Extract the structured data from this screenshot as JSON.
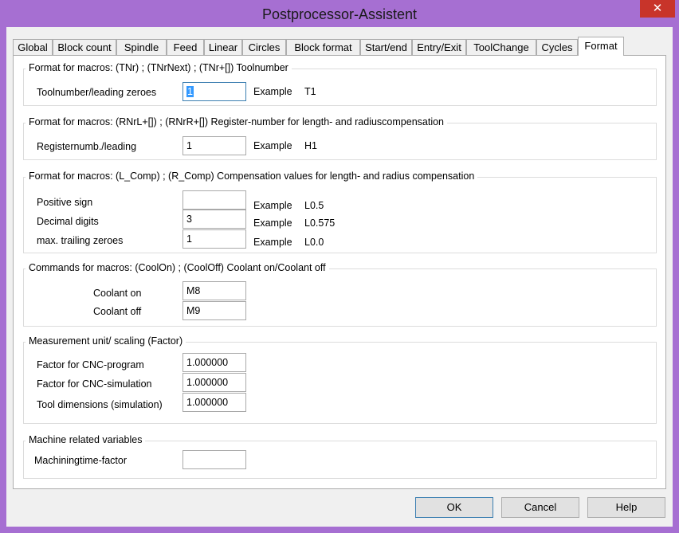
{
  "window": {
    "title": "Postprocessor-Assistent",
    "close_glyph": "✕"
  },
  "tabs": [
    {
      "label": "Global"
    },
    {
      "label": "Block count"
    },
    {
      "label": "Spindle"
    },
    {
      "label": "Feed"
    },
    {
      "label": "Linear"
    },
    {
      "label": "Circles"
    },
    {
      "label": "Block format"
    },
    {
      "label": "Start/end"
    },
    {
      "label": "Entry/Exit"
    },
    {
      "label": "ToolChange"
    },
    {
      "label": "Cycles"
    },
    {
      "label": "Format"
    }
  ],
  "groups": {
    "toolnumber": {
      "title": "Format for macros:  (TNr) ; (TNrNext) ; (TNr+[])   Toolnumber",
      "label": "Toolnumber/leading zeroes",
      "value": "1",
      "example_label": "Example",
      "example_value": "T1"
    },
    "register": {
      "title": "Format for macros:  (RNrL+[]) ; (RNrR+[])   Register-number for length- and radiuscompensation",
      "label": "Registernumb./leading",
      "value": "1",
      "example_label": "Example",
      "example_value": "H1"
    },
    "compensation": {
      "title": "Format for macros: (L_Comp)  ;  (R_Comp)    Compensation values for length- and radius compensation",
      "rows": [
        {
          "label": "Positive sign",
          "value": "",
          "example_label": "Example",
          "example_value": "L0.5"
        },
        {
          "label": "Decimal digits",
          "value": "3",
          "example_label": "Example",
          "example_value": "L0.575"
        },
        {
          "label": "max. trailing zeroes",
          "value": "1",
          "example_label": "Example",
          "example_value": "L0.0"
        }
      ]
    },
    "coolant": {
      "title": "Commands for macros:  (CoolOn) ; (CoolOff)  Coolant on/Coolant off",
      "rows": [
        {
          "label": "Coolant on",
          "value": "M8"
        },
        {
          "label": "Coolant off",
          "value": "M9"
        }
      ]
    },
    "scaling": {
      "title": "Measurement unit/ scaling (Factor)",
      "rows": [
        {
          "label": "Factor for CNC-program",
          "value": "1.000000"
        },
        {
          "label": "Factor for CNC-simulation",
          "value": "1.000000"
        },
        {
          "label": "Tool dimensions (simulation)",
          "value": "1.000000"
        }
      ]
    },
    "machine": {
      "title": "Machine related variables",
      "label": "Machiningtime-factor",
      "value": ""
    }
  },
  "buttons": {
    "ok": "OK",
    "cancel": "Cancel",
    "help": "Help"
  }
}
